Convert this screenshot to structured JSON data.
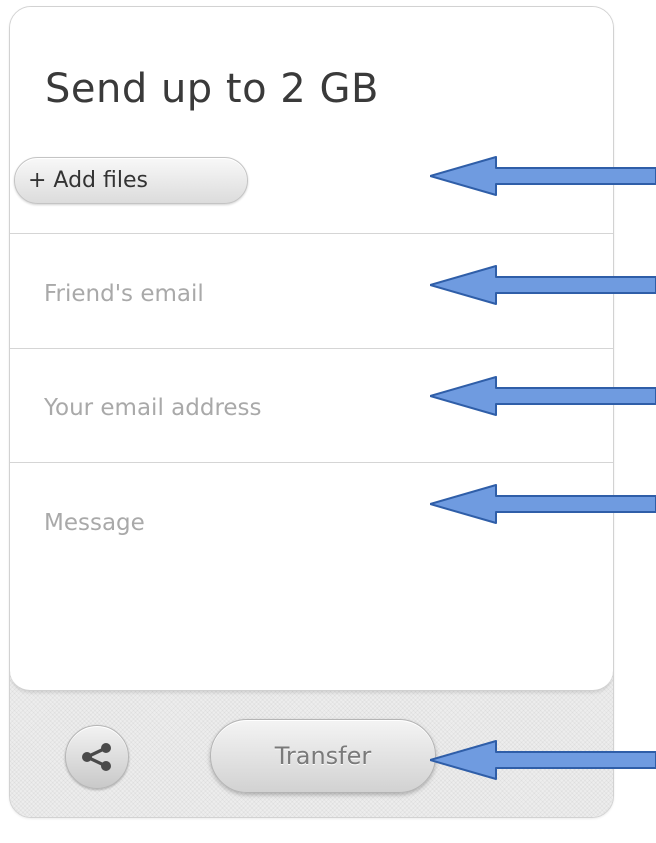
{
  "form": {
    "title": "Send up to 2 GB",
    "add_files_label": "+ Add files",
    "friend_email_placeholder": "Friend's email",
    "your_email_placeholder": "Your email address",
    "message_placeholder": "Message"
  },
  "footer": {
    "share_icon": "share-icon",
    "transfer_label": "Transfer"
  },
  "annotations": {
    "arrow_color": "#6f9be0",
    "arrow_icon": "left-arrow-icon"
  }
}
